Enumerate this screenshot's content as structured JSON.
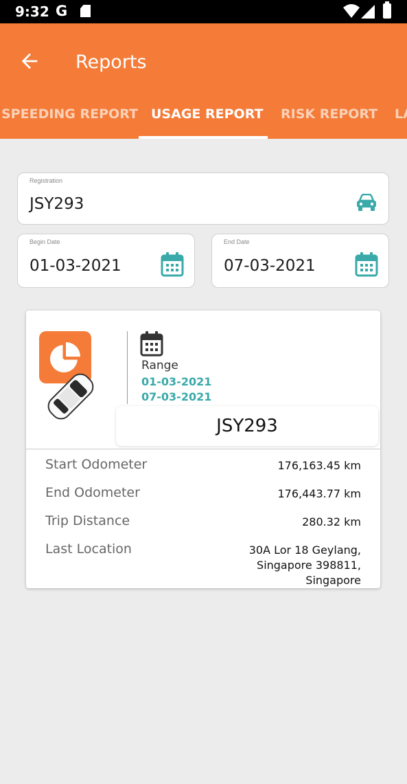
{
  "status_bar": {
    "time": "9:32",
    "google_glyph": "G"
  },
  "app_bar": {
    "title": "Reports",
    "back_icon": "arrow-left-icon"
  },
  "tabs": [
    {
      "label": "SPEEDING REPORT",
      "active": false
    },
    {
      "label": "USAGE REPORT",
      "active": true
    },
    {
      "label": "RISK REPORT",
      "active": false
    },
    {
      "label": "LA",
      "active": false
    }
  ],
  "form": {
    "registration": {
      "label": "Registration",
      "value": "JSY293",
      "icon": "car-icon"
    },
    "begin_date": {
      "label": "Begin Date",
      "value": "01-03-2021",
      "icon": "calendar-icon"
    },
    "end_date": {
      "label": "End Date",
      "value": "07-03-2021",
      "icon": "calendar-icon"
    }
  },
  "report_card": {
    "range_label": "Range",
    "range_start": "01-03-2021",
    "range_end": "07-03-2021",
    "registration": "JSY293",
    "rows": [
      {
        "label": "Start Odometer",
        "value": "176,163.45 km"
      },
      {
        "label": "End Odometer",
        "value": "176,443.77 km"
      },
      {
        "label": "Trip Distance",
        "value": "280.32 km"
      },
      {
        "label": "Last Location",
        "value_lines": [
          "30A Lor 18 Geylang,",
          "Singapore 398811,",
          "Singapore"
        ]
      }
    ]
  },
  "colors": {
    "primary": "#f47b38",
    "accent": "#3aa9a9",
    "background": "#ececec"
  }
}
